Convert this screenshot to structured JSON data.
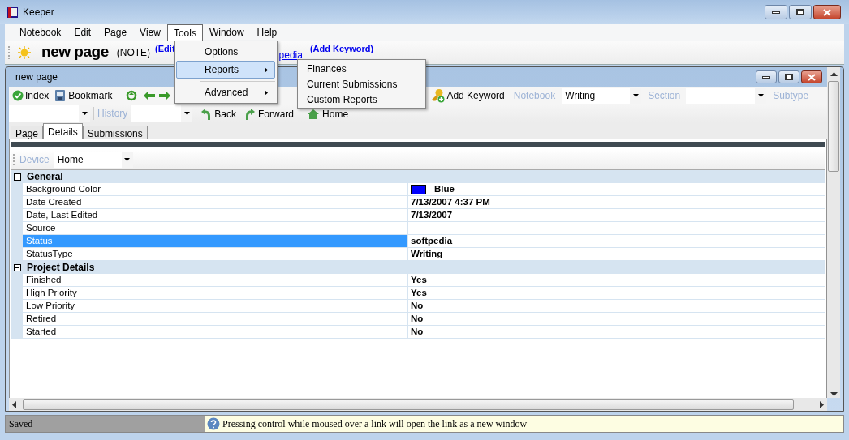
{
  "window": {
    "title": "Keeper"
  },
  "menu_bar": [
    {
      "label": "Notebook",
      "selected": false
    },
    {
      "label": "Edit",
      "selected": false
    },
    {
      "label": "Page",
      "selected": false
    },
    {
      "label": "View",
      "selected": false
    },
    {
      "label": "Tools",
      "selected": true
    },
    {
      "label": "Window",
      "selected": false
    },
    {
      "label": "Help",
      "selected": false
    }
  ],
  "open_menu": {
    "items": [
      {
        "kind": "item",
        "label": "Options",
        "selected": false
      },
      {
        "kind": "submenu",
        "label": "Reports",
        "selected": true
      },
      {
        "kind": "separator"
      },
      {
        "kind": "submenu",
        "label": "Advanced",
        "selected": false
      }
    ],
    "submenu": [
      "Finances",
      "Current Submissions",
      "Custom Reports"
    ]
  },
  "page_header": {
    "title": "new page",
    "type": "(NOTE)",
    "links": [
      "(Edit",
      "pedia",
      "(Add Keyword)"
    ]
  },
  "document": {
    "title": "new page",
    "toolbar": {
      "buttons": [
        "Index",
        "Bookmark"
      ],
      "add_keyword": "Add Keyword",
      "notebook_label": "Notebook",
      "notebook_value": "Writing",
      "section_label": "Section",
      "subtype_label": "Subtype",
      "history_label": "History",
      "nav_buttons": [
        "Back",
        "Forward",
        "Home"
      ]
    },
    "tabs": [
      {
        "label": "Page",
        "selected": false
      },
      {
        "label": "Details",
        "selected": true
      },
      {
        "label": "Submissions",
        "selected": false
      }
    ],
    "device": {
      "label": "Device",
      "value": "Home"
    },
    "properties": [
      {
        "category": "General",
        "expanded": true,
        "rows": [
          {
            "name": "Background Color",
            "value": "Blue",
            "color": "#0000ff",
            "selected": false
          },
          {
            "name": "Date Created",
            "value": "7/13/2007 4:37 PM",
            "selected": false
          },
          {
            "name": "Date, Last Edited",
            "value": "7/13/2007",
            "selected": false
          },
          {
            "name": "Source",
            "selected": false
          },
          {
            "name": "Status",
            "value": "softpedia",
            "selected": true
          },
          {
            "name": "StatusType",
            "value": "Writing",
            "selected": false
          }
        ]
      },
      {
        "category": "Project Details",
        "expanded": true,
        "rows": [
          {
            "name": "Finished",
            "value": "Yes",
            "selected": false
          },
          {
            "name": "High Priority",
            "value": "Yes",
            "selected": false
          },
          {
            "name": "Low Priority",
            "value": "No",
            "selected": false
          },
          {
            "name": "Retired",
            "value": "No",
            "selected": false
          },
          {
            "name": "Started",
            "value": "No",
            "selected": false
          }
        ]
      }
    ]
  },
  "status_bar": {
    "state": "Saved",
    "hint": "Pressing control while moused over a link will open the link as a new window"
  }
}
